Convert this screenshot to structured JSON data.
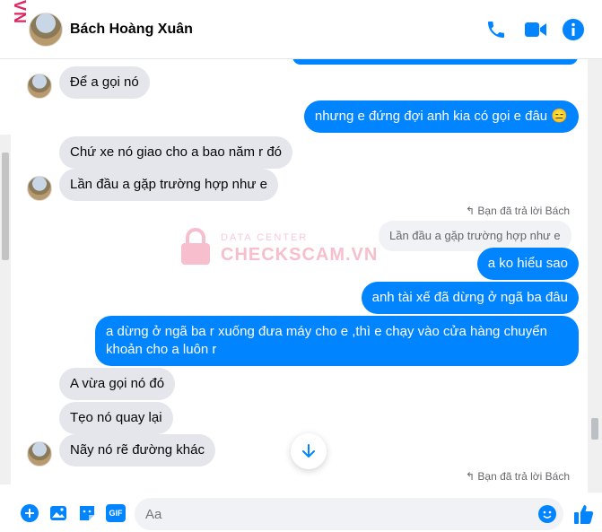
{
  "header": {
    "brand_strip": "VN",
    "contact_name": "Bách Hoàng Xuân",
    "icons": [
      "phone-icon",
      "video-icon",
      "info-icon"
    ]
  },
  "watermark": {
    "top_text": "DATA CENTER",
    "main_text": "CHECKSCAM.VN"
  },
  "messages": {
    "m1": "Để a gọi nó",
    "m2": "nhưng e đứng đợi anh kia có gọi e đâu 😑",
    "m3": "Chứ xe nó giao cho a bao năm r đó",
    "m4": "Lần đầu a gặp trường hợp như e",
    "reply_note_1": "Bạn đã trả lời Bách",
    "m5_quote": "Lần đầu a gặp trường hợp như e",
    "m6": "a ko hiểu sao",
    "m7": "anh tài xế đã dừng ở ngã ba đâu",
    "m8_line1": "a dừng ở ngã ba r xuống đưa máy cho e ,thì e chạy vào cửa hàng chuyển",
    "m8_line2": "khoản cho a luôn r",
    "m9": "A vừa gọi nó đó",
    "m10": "Tẹo nó quay lại",
    "m11": "Nãy nó rẽ đường khác",
    "reply_note_2": "Bạn đã trả lời Bách"
  },
  "composer": {
    "placeholder": "Aa",
    "icons": [
      "plus-icon",
      "image-icon",
      "sticker-icon",
      "gif-icon",
      "emoji-icon",
      "like-icon"
    ],
    "gif_label": "GIF"
  },
  "colors": {
    "accent": "#0084ff",
    "incoming": "#e4e6eb",
    "brand_pink": "#e0245e"
  }
}
